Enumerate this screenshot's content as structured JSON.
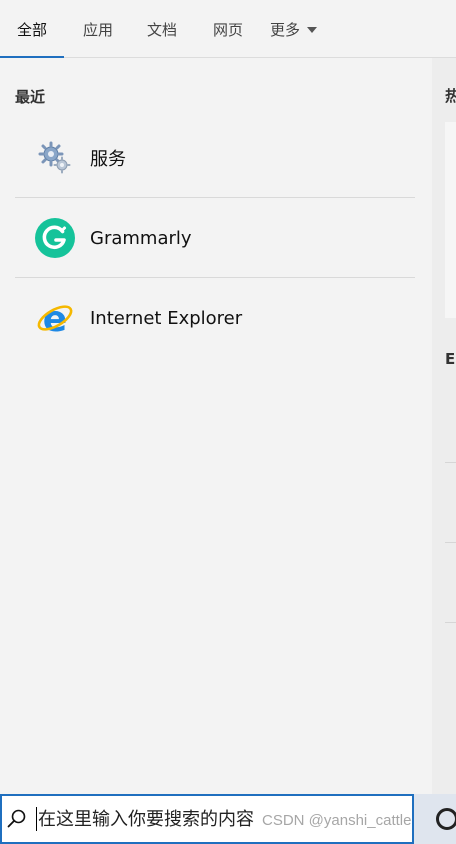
{
  "tabs": [
    {
      "label": "全部",
      "active": true
    },
    {
      "label": "应用",
      "active": false
    },
    {
      "label": "文档",
      "active": false
    },
    {
      "label": "网页",
      "active": false
    },
    {
      "label": "更多",
      "active": false
    }
  ],
  "recent": {
    "title": "最近",
    "items": [
      {
        "label": "服务",
        "icon": "services-gear-icon"
      },
      {
        "label": "Grammarly",
        "icon": "grammarly-icon"
      },
      {
        "label": "Internet Explorer",
        "icon": "internet-explorer-icon"
      }
    ]
  },
  "right_pane": {
    "heading": "热",
    "heading2": "E"
  },
  "search": {
    "placeholder": "在这里输入你要搜索的内容",
    "value": ""
  },
  "watermark": "CSDN @yanshi_cattle",
  "colors": {
    "accent": "#1f6fbf",
    "grammarly": "#15c39a",
    "ie_blue": "#1e88e5",
    "ie_ring": "#f5b800"
  }
}
